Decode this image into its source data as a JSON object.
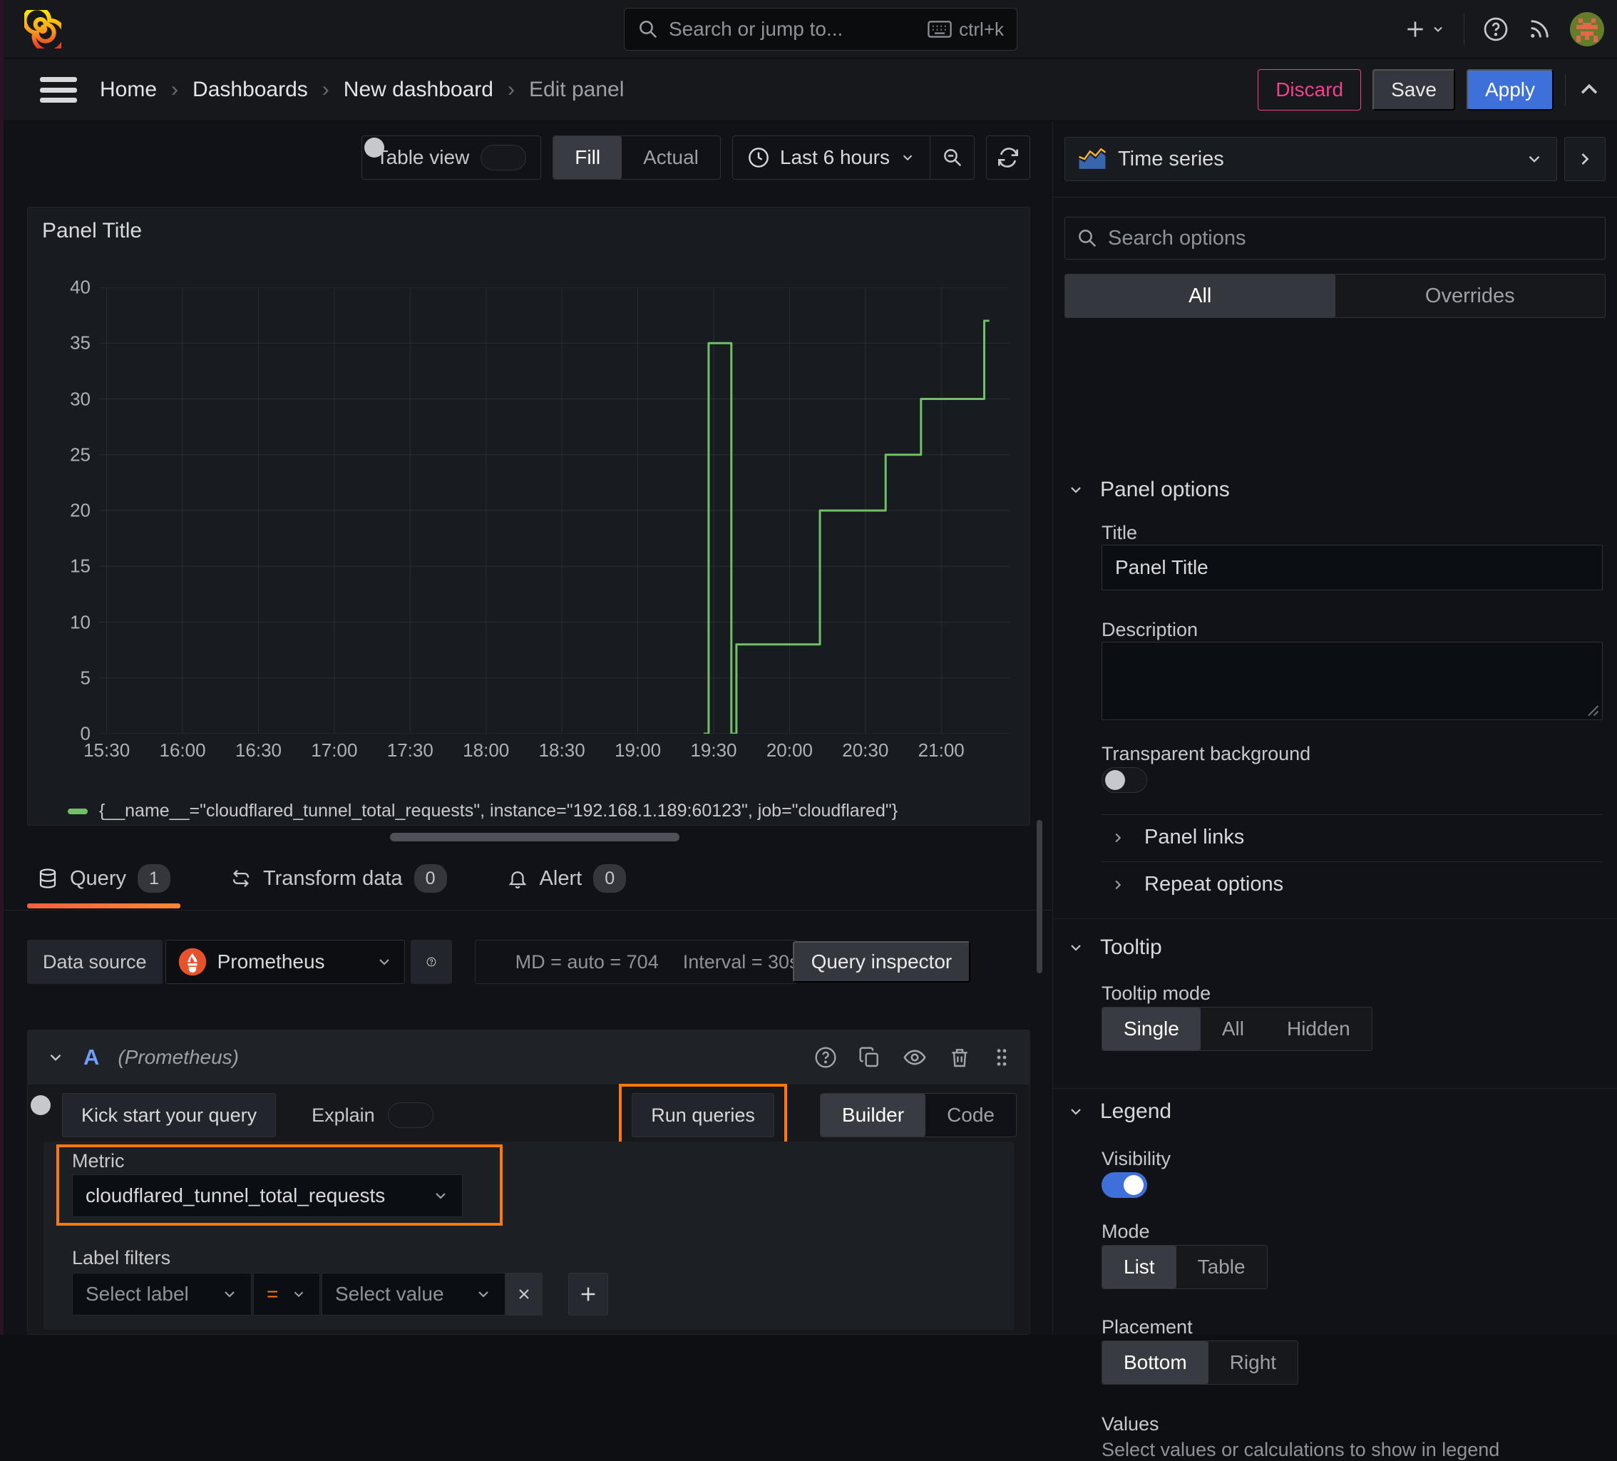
{
  "topbar": {
    "search_placeholder": "Search or jump to...",
    "shortcut": "ctrl+k"
  },
  "nav": {
    "breadcrumb": [
      "Home",
      "Dashboards",
      "New dashboard",
      "Edit panel"
    ],
    "discard": "Discard",
    "save": "Save",
    "apply": "Apply"
  },
  "toolbar": {
    "table_view": "Table view",
    "fill": "Fill",
    "actual": "Actual",
    "time_range": "Last 6 hours"
  },
  "panel": {
    "title": "Panel Title"
  },
  "tabs": {
    "query": "Query",
    "query_count": "1",
    "transform": "Transform data",
    "transform_count": "0",
    "alert": "Alert",
    "alert_count": "0"
  },
  "datasource": {
    "label": "Data source",
    "name": "Prometheus",
    "md": "MD = auto = 704",
    "interval": "Interval = 30s",
    "inspector": "Query inspector"
  },
  "query": {
    "ref": "A",
    "hint": "(Prometheus)",
    "kickstart": "Kick start your query",
    "explain": "Explain",
    "run": "Run queries",
    "builder": "Builder",
    "code": "Code",
    "metric_label": "Metric",
    "metric_value": "cloudflared_tunnel_total_requests",
    "filters_label": "Label filters",
    "select_label": "Select label",
    "operator": "=",
    "select_value": "Select value"
  },
  "options": {
    "viz": "Time series",
    "search_placeholder": "Search options",
    "all": "All",
    "overrides": "Overrides",
    "panel_options": "Panel options",
    "title_label": "Title",
    "title_value": "Panel Title",
    "description_label": "Description",
    "transparent": "Transparent background",
    "panel_links": "Panel links",
    "repeat_options": "Repeat options",
    "tooltip": "Tooltip",
    "tooltip_mode": "Tooltip mode",
    "modes": [
      "Single",
      "All",
      "Hidden"
    ],
    "legend": "Legend",
    "visibility": "Visibility",
    "mode_label": "Mode",
    "legend_modes": [
      "List",
      "Table"
    ],
    "placement": "Placement",
    "placements": [
      "Bottom",
      "Right"
    ],
    "values_label": "Values",
    "values_help": "Select values or calculations to show in legend"
  },
  "chart_data": {
    "type": "line",
    "title": "Panel Title",
    "x_ticks": [
      "15:30",
      "16:00",
      "16:30",
      "17:00",
      "17:30",
      "18:00",
      "18:30",
      "19:00",
      "19:30",
      "20:00",
      "20:30",
      "21:00"
    ],
    "y_ticks": [
      0,
      5,
      10,
      15,
      20,
      25,
      30,
      35,
      40
    ],
    "x_range_minutes": [
      927,
      1287
    ],
    "y_range": [
      0,
      40
    ],
    "grid": true,
    "legend_position": "bottom",
    "series": [
      {
        "name": "{__name__=\"cloudflared_tunnel_total_requests\", instance=\"192.168.1.189:60123\", job=\"cloudflared\"}",
        "color": "#73bf69",
        "line_style": "step-after",
        "steps": [
          [
            "19:26",
            0
          ],
          [
            "19:28",
            35
          ],
          [
            "19:37",
            0
          ],
          [
            "19:39",
            8
          ],
          [
            "20:12",
            20
          ],
          [
            "20:38",
            25
          ],
          [
            "20:52",
            30
          ],
          [
            "21:17",
            37
          ]
        ],
        "end_time": "21:19"
      }
    ]
  },
  "colors": {
    "accent_blue": "#3d71d9",
    "highlight_orange": "#ff780a",
    "series_green": "#73bf69",
    "danger_pink": "#f0418c"
  }
}
